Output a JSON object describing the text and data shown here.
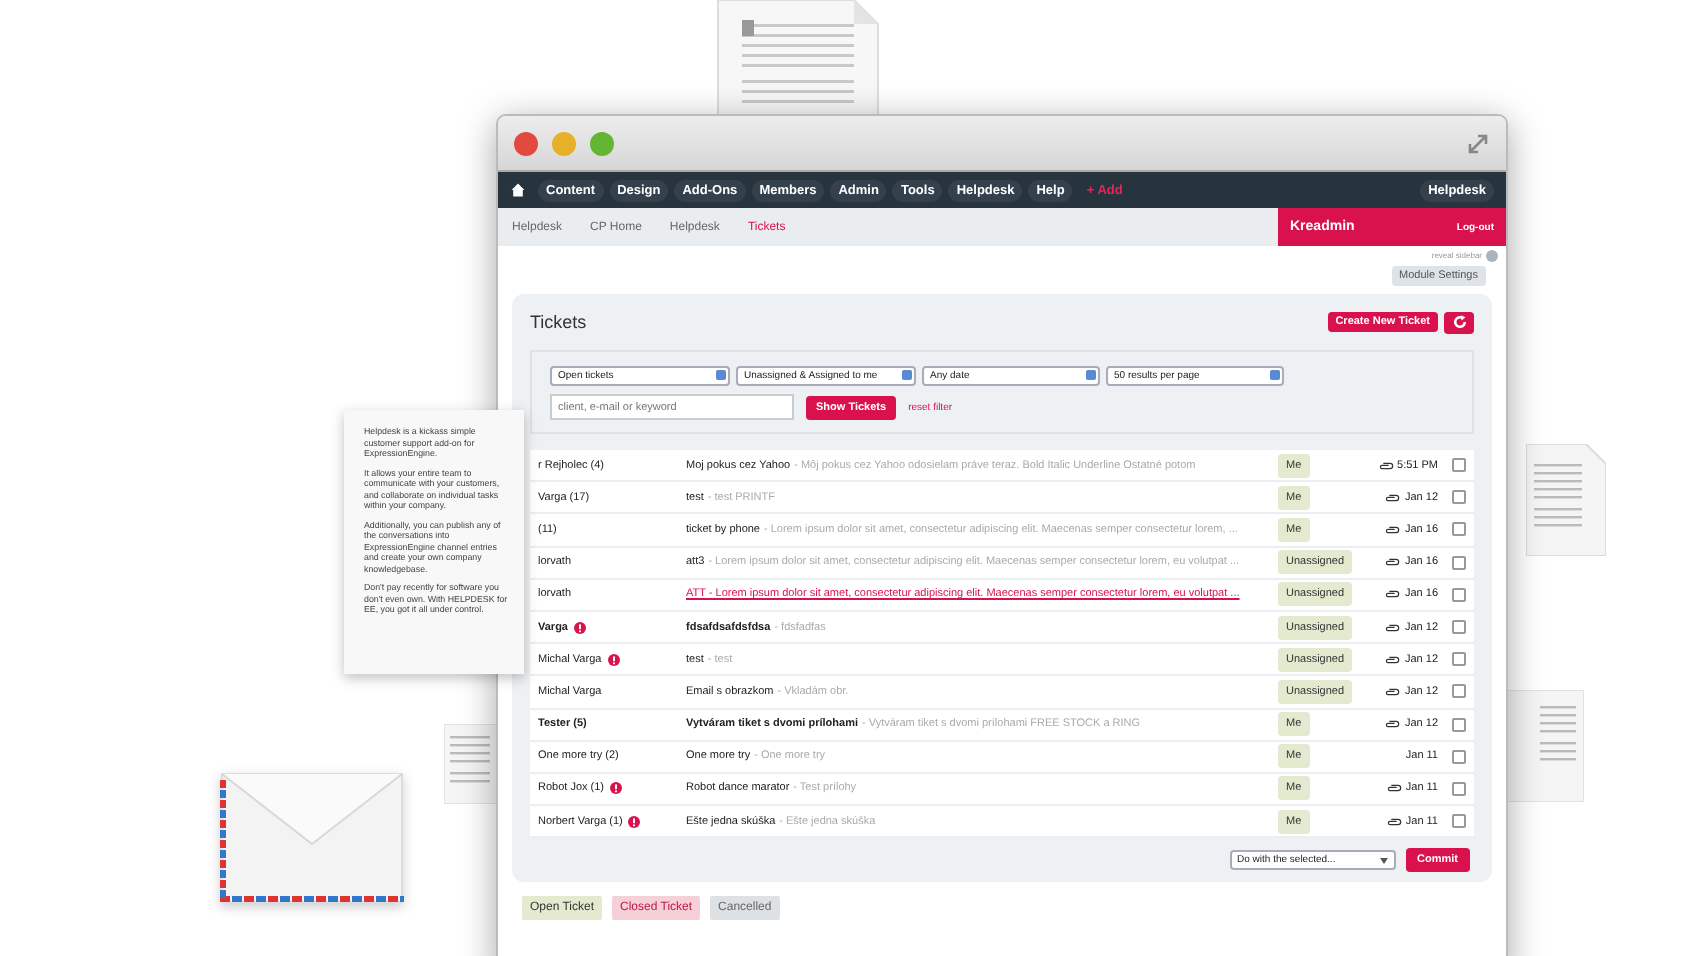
{
  "window": {
    "nav": [
      {
        "label": "Content",
        "kind": "item"
      },
      {
        "label": "Design",
        "kind": "item"
      },
      {
        "label": "Add-Ons",
        "kind": "item"
      },
      {
        "label": "Members",
        "kind": "item"
      },
      {
        "label": "Admin",
        "kind": "item"
      },
      {
        "label": "Tools",
        "kind": "item"
      },
      {
        "label": "Helpdesk",
        "kind": "item"
      },
      {
        "label": "Help",
        "kind": "item"
      },
      {
        "label": "+ Add",
        "kind": "add"
      }
    ],
    "nav_right": "Helpdesk",
    "breadcrumb": [
      {
        "label": "Helpdesk",
        "selected": false
      },
      {
        "label": "CP Home",
        "selected": false
      },
      {
        "label": "Helpdesk",
        "selected": false
      },
      {
        "label": "Tickets",
        "selected": true
      }
    ],
    "user": {
      "name": "Kreadmin",
      "logout": "Log-out"
    },
    "sidebar_toggle": "reveal sidebar",
    "module_settings": "Module Settings",
    "tickets": {
      "title": "Tickets",
      "create_button": "Create New Ticket",
      "filters": [
        "Open tickets",
        "Unassigned & Assigned to me",
        "Any date",
        "50 results per page"
      ],
      "search": {
        "placeholder": "client, e-mail or keyword"
      },
      "show_button": "Show Tickets",
      "reset": "reset filter",
      "rows": [
        {
          "name": "r Rejholec (4)",
          "alert": false,
          "unread": false,
          "flagged": false,
          "subject": "Moj pokus cez Yahoo",
          "preview": "- Môj pokus cez Yahoo odosielam práve teraz. Bold Italic Underline Ostatné potom",
          "assignee": "Me",
          "attachment": true,
          "date": "5:51 PM",
          "checked": false
        },
        {
          "name": "Varga (17)",
          "alert": false,
          "unread": false,
          "flagged": false,
          "subject": "test",
          "preview": "- test PRINTF",
          "assignee": "Me",
          "attachment": true,
          "date": "Jan 12",
          "checked": false
        },
        {
          "name": "(11)",
          "alert": false,
          "unread": false,
          "flagged": false,
          "subject": "ticket by phone",
          "preview": "- Lorem ipsum dolor sit amet, consectetur adipiscing elit. Maecenas semper consectetur lorem, ...",
          "assignee": "Me",
          "attachment": true,
          "date": "Jan 16",
          "checked": false
        },
        {
          "name": "lorvath",
          "alert": false,
          "unread": false,
          "flagged": false,
          "subject": "att3",
          "preview": "- Lorem ipsum dolor sit amet, consectetur adipiscing elit. Maecenas semper consectetur lorem, eu volutpat ...",
          "assignee": "Unassigned",
          "attachment": true,
          "date": "Jan 16",
          "checked": false
        },
        {
          "name": "lorvath",
          "alert": false,
          "unread": false,
          "flagged": true,
          "subject": "ATT - Lorem ipsum dolor sit amet, consectetur adipiscing elit. Maecenas semper consectetur lorem, eu volutpat ...",
          "assignee": "Unassigned",
          "attachment": true,
          "date": "Jan 16",
          "checked": false
        },
        {
          "name": "Varga",
          "alert": true,
          "unread": true,
          "flagged": false,
          "subject": "fdsafdsafdsfdsa",
          "preview": "- fdsfadfas",
          "assignee": "Unassigned",
          "attachment": true,
          "date": "Jan 12",
          "checked": false
        },
        {
          "name": "Michal Varga",
          "alert": true,
          "unread": false,
          "flagged": false,
          "subject": "test",
          "preview": "- test",
          "assignee": "Unassigned",
          "attachment": true,
          "date": "Jan 12",
          "checked": false
        },
        {
          "name": "Michal Varga",
          "alert": false,
          "unread": false,
          "flagged": false,
          "subject": "Email s obrazkom",
          "preview": "- Vkladám obr.",
          "assignee": "Unassigned",
          "attachment": true,
          "date": "Jan 12",
          "checked": false
        },
        {
          "name": "Tester (5)",
          "alert": false,
          "unread": true,
          "flagged": false,
          "subject": "Vytváram tiket s dvomi prílohami",
          "preview": "- Vytváram tiket s dvomi prílohami FREE STOCK a RING",
          "assignee": "Me",
          "attachment": true,
          "date": "Jan 12",
          "checked": false
        },
        {
          "name": "One more try (2)",
          "alert": false,
          "unread": false,
          "flagged": false,
          "subject": "One more try",
          "preview": "- One more try",
          "assignee": "Me",
          "attachment": false,
          "date": "Jan 11",
          "checked": false
        },
        {
          "name": "Robot Jox (1)",
          "alert": true,
          "unread": false,
          "flagged": false,
          "subject": "Robot dance marator",
          "preview": "- Test prílohy",
          "assignee": "Me",
          "attachment": true,
          "date": "Jan 11",
          "checked": false
        },
        {
          "name": "Norbert Varga (1)",
          "alert": true,
          "unread": false,
          "flagged": false,
          "subject": "Ešte jedna skúška",
          "preview": "- Ešte jedna skúška",
          "assignee": "Me",
          "attachment": true,
          "date": "Jan 11",
          "checked": false
        }
      ],
      "bulk_action": "Do with the selected...",
      "commit": "Commit"
    },
    "legend": [
      {
        "label": "Open Ticket",
        "kind": "open"
      },
      {
        "label": "Closed Ticket",
        "kind": "closed"
      },
      {
        "label": "Cancelled",
        "kind": "cancelled"
      }
    ]
  },
  "note": [
    "Helpdesk is a kickass simple customer support add-on for ExpressionEngine.",
    "It allows your entire team to communicate with your customers, and collaborate on individual tasks within your company.",
    "Additionally, you can publish any of the conversations into ExpressionEngine channel entries and create your own company knowledgebase.",
    "Don't pay recently for software you don't even own. With HELPDESK for EE, you got it all under control."
  ]
}
